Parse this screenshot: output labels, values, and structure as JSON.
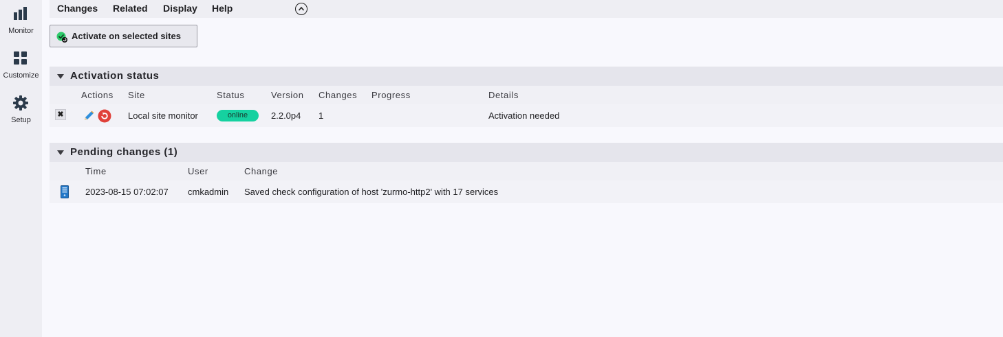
{
  "sidebar": {
    "items": [
      {
        "label": "Monitor",
        "icon": "bar-chart-icon"
      },
      {
        "label": "Customize",
        "icon": "grid-icon"
      },
      {
        "label": "Setup",
        "icon": "gear-icon"
      }
    ]
  },
  "menubar": {
    "items": [
      "Changes",
      "Related",
      "Display",
      "Help"
    ]
  },
  "activate_button": {
    "label": "Activate on selected sites"
  },
  "activation_status": {
    "title": "Activation status",
    "columns": [
      "Actions",
      "Site",
      "Status",
      "Version",
      "Changes",
      "Progress",
      "Details"
    ],
    "rows": [
      {
        "site": "Local site monitor",
        "status": "online",
        "version": "2.2.0p4",
        "changes": "1",
        "progress": "",
        "details": "Activation needed"
      }
    ]
  },
  "pending_changes": {
    "title": "Pending changes (1)",
    "columns": [
      "Time",
      "User",
      "Change"
    ],
    "rows": [
      {
        "time": "2023-08-15 07:02:07",
        "user": "cmkadmin",
        "change": "Saved check configuration of host 'zurmo-http2' with 17 services"
      }
    ]
  },
  "colors": {
    "status_online": "#15d1a0",
    "accent_green": "#2fcb6b",
    "restart_red": "#e0413a"
  }
}
